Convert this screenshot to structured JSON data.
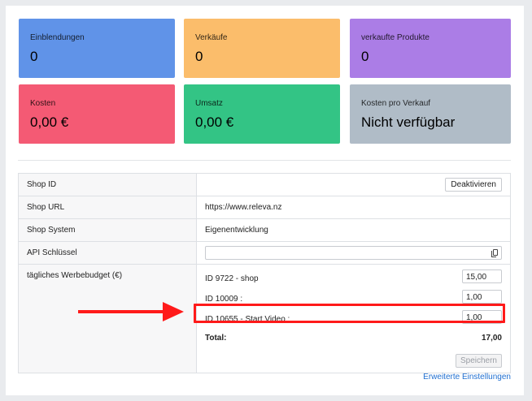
{
  "cards": [
    {
      "label": "Einblendungen",
      "value": "0",
      "color": "#6093e8"
    },
    {
      "label": "Verkäufe",
      "value": "0",
      "color": "#fbbd6b"
    },
    {
      "label": "verkaufte Produkte",
      "value": "0",
      "color": "#ab7de6"
    },
    {
      "label": "Kosten",
      "value": "0,00 €",
      "color": "#f45a74"
    },
    {
      "label": "Umsatz",
      "value": "0,00 €",
      "color": "#33c485"
    },
    {
      "label": "Kosten pro Verkauf",
      "value": "Nicht verfügbar",
      "color": "#b0bcc7"
    }
  ],
  "details": {
    "shop_id_label": "Shop ID",
    "deactivate_label": "Deaktivieren",
    "shop_url_label": "Shop URL",
    "shop_url_value": "https://www.releva.nz",
    "shop_system_label": "Shop System",
    "shop_system_value": "Eigenentwicklung",
    "api_key_label": "API Schlüssel",
    "api_key_value": "",
    "budget_label": "tägliches Werbebudget (€)"
  },
  "budgets": [
    {
      "label": "ID 9722 - shop",
      "value": "15,00"
    },
    {
      "label": "ID 10009 :",
      "value": "1,00"
    },
    {
      "label": "ID 10655 - Start Video :",
      "value": "1,00"
    }
  ],
  "total": {
    "label": "Total:",
    "value": "17,00"
  },
  "save_label": "Speichern",
  "advanced_link": "Erweiterte Einstellungen",
  "annotation_color": "#ff1a1a"
}
